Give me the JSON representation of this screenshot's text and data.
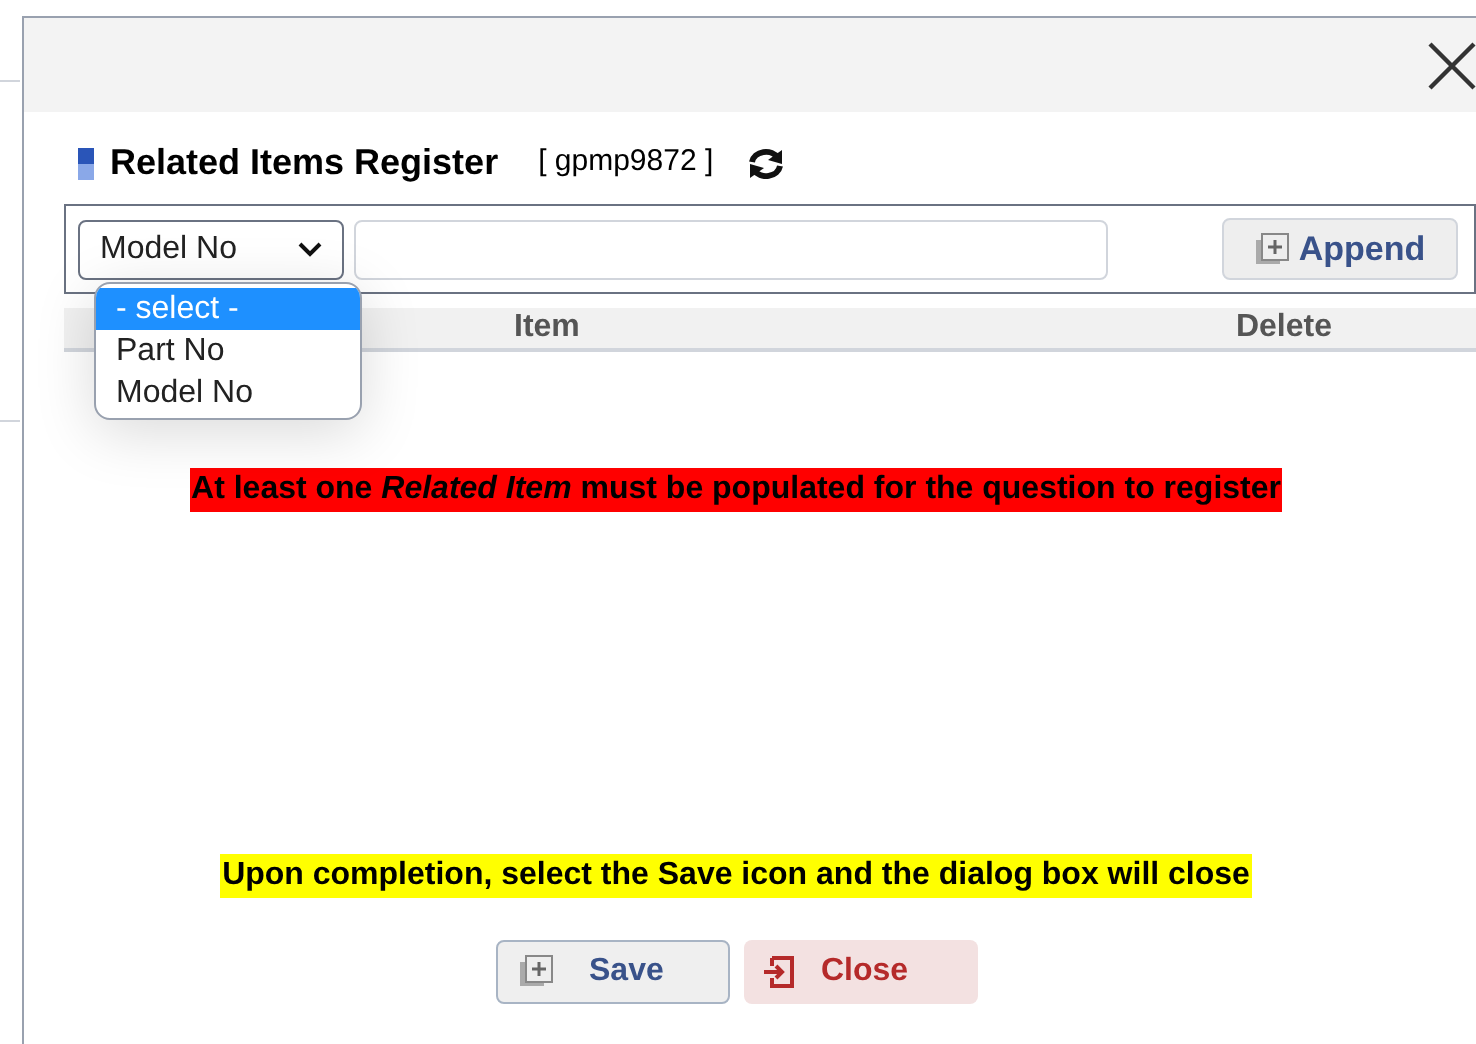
{
  "dialog": {
    "title": "Related Items Register",
    "code": "[ gpmp9872 ]"
  },
  "form": {
    "type_select": {
      "value": "Model No",
      "expanded": true,
      "options": [
        {
          "label": "- select -",
          "highlighted": true
        },
        {
          "label": "Part No",
          "highlighted": false
        },
        {
          "label": "Model No",
          "highlighted": false
        }
      ]
    },
    "append_button": "Append"
  },
  "table": {
    "columns": [
      "Item",
      "Delete"
    ]
  },
  "notes": [
    {
      "text": "At least one *Related Item* must be populated for the question to register",
      "color": "#ff0000"
    },
    {
      "text": "Upon completion, select the Save icon and the dialog box will close",
      "color": "#ffff00"
    }
  ],
  "buttons": [
    {
      "label": "Save",
      "kind": "save"
    },
    {
      "label": "Close",
      "kind": "close"
    }
  ]
}
